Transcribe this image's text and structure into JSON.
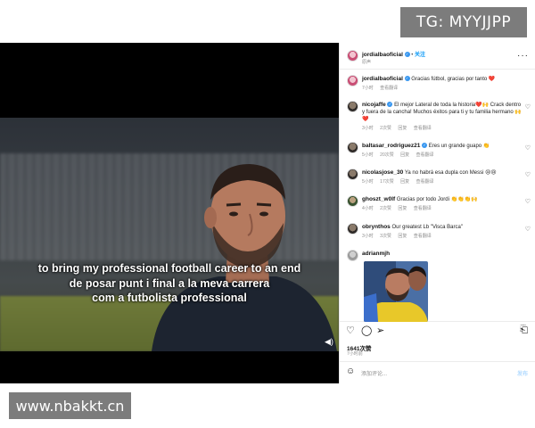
{
  "watermarks": {
    "top": "TG: MYYJJPP",
    "bottom": "www.nbakkt.cn"
  },
  "video": {
    "subtitle_line1": "to bring my professional football career to an end",
    "subtitle_line2": "de posar punt i final a la meva carrera",
    "subtitle_line3": "com a futbolista professional",
    "volume_icon": "speaker-icon"
  },
  "post": {
    "author": "jordialbaoficial",
    "follow_label": "关注",
    "location": "原声",
    "more_icon": "more-horizontal-icon",
    "caption_user": "jordialbaoficial",
    "caption_text": "Gracias fútbol, gracias por tanto ❤️",
    "caption_time": "7小时",
    "caption_translate": "查看翻译",
    "comments": [
      {
        "user": "nicojaffe",
        "verified": true,
        "text": "El mejor Lateral de toda la historia❤️🙌 Crack dentro y fuera de la cancha! Muchos éxitos para ti y tu familia hermano 🙌❤️",
        "time": "3小时",
        "likes": "2次赞",
        "reply": "回复",
        "translate": "查看翻译"
      },
      {
        "user": "baltasar_rodriguez21",
        "verified": true,
        "text": "Eres un grande guapo 👏",
        "time": "5小时",
        "likes": "20次赞",
        "reply": "回复",
        "translate": "查看翻译"
      },
      {
        "user": "nicolasjose_30",
        "verified": false,
        "text": "Ya no habrá esa dupla con Messi 😢😢",
        "time": "5小时",
        "likes": "17次赞",
        "reply": "回复",
        "translate": "查看翻译"
      },
      {
        "user": "ghoszt_w0lf",
        "verified": false,
        "text": "Gracias por todo Jordi 👏👏👏🙌",
        "time": "4小时",
        "likes": "2次赞",
        "reply": "回复",
        "translate": "查看翻译"
      },
      {
        "user": "obrynthos",
        "verified": false,
        "text": "Our greatest Lb \"Visca Barca\"",
        "time": "3小时",
        "likes": "3次赞",
        "reply": "回复",
        "translate": "查看翻译"
      },
      {
        "user": "adrianmjh",
        "verified": false,
        "text": "",
        "time": "",
        "likes": "",
        "reply": "",
        "translate": ""
      }
    ],
    "likes_count": "1641次赞",
    "post_time": "7小时前",
    "comment_placeholder": "添加评论...",
    "post_button": "发布"
  },
  "colors": {
    "accent": "#0095f6",
    "verified": "#3897f0",
    "heart": "#e0245e"
  }
}
